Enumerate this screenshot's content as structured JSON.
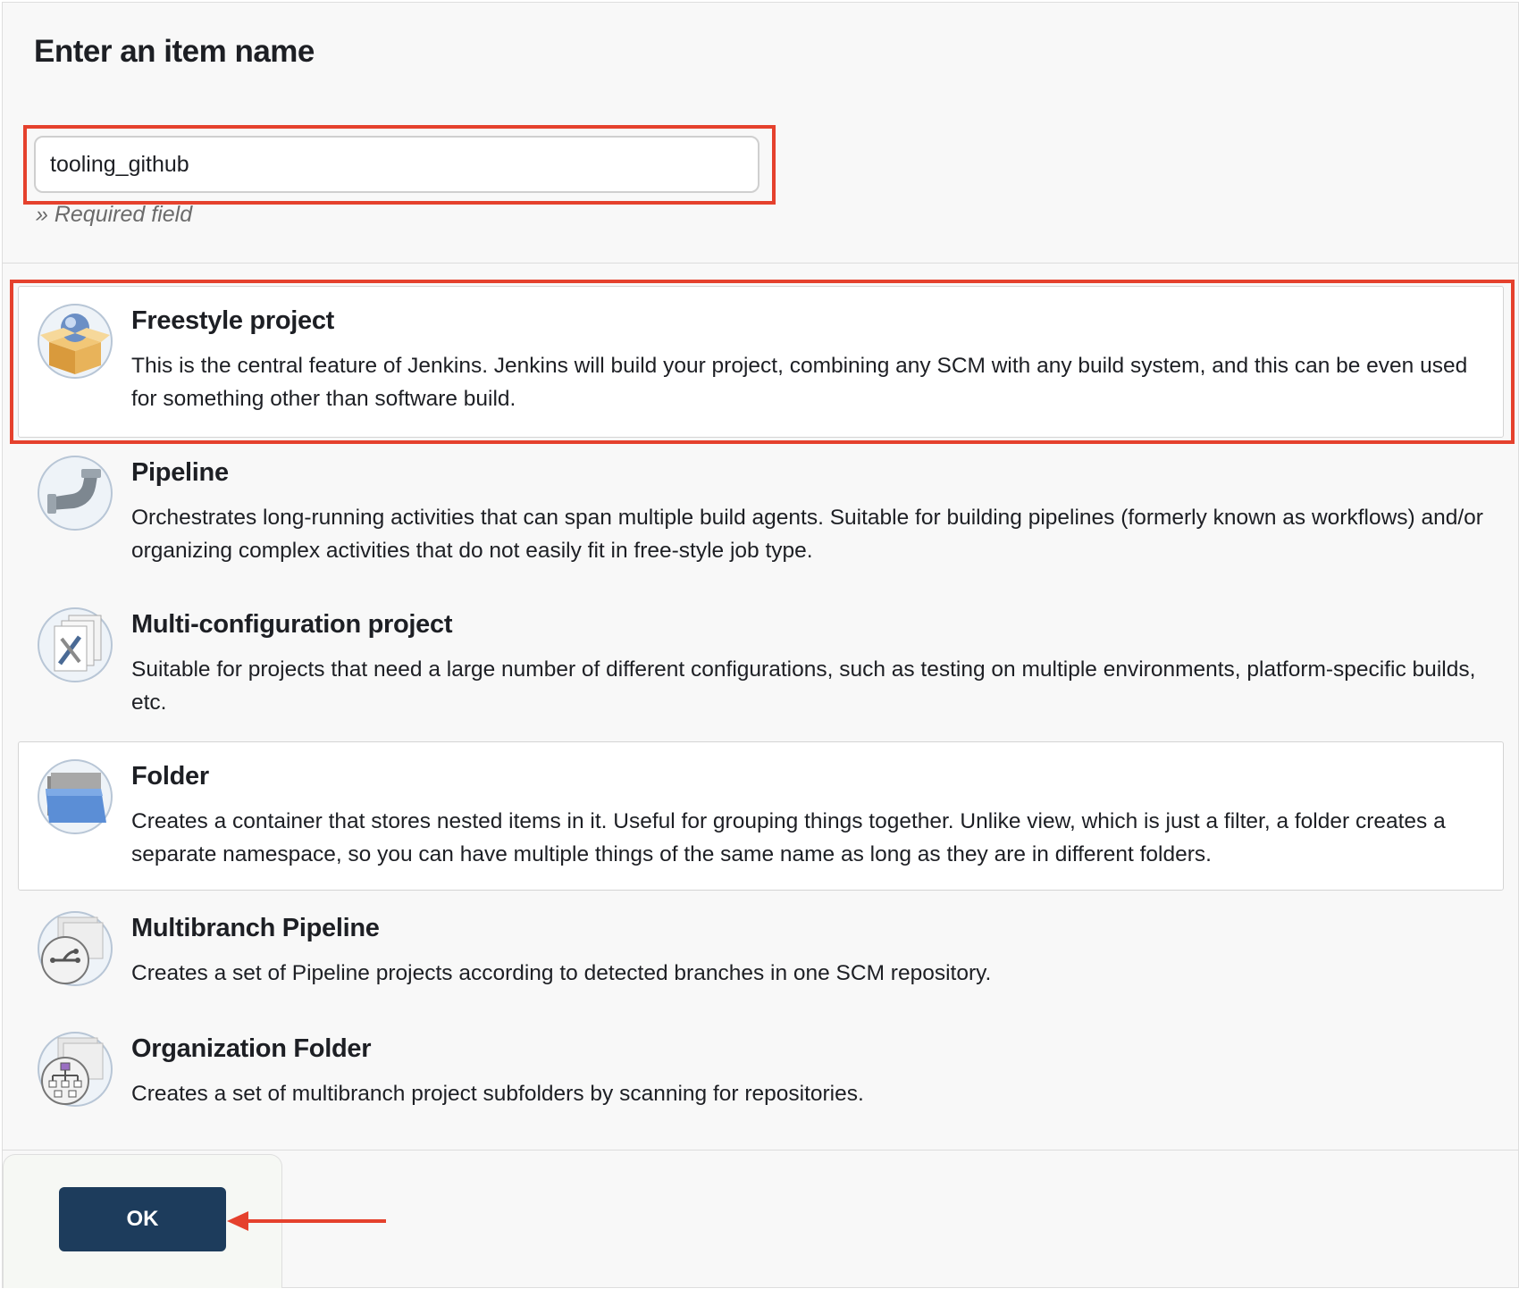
{
  "header": {
    "title": "Enter an item name"
  },
  "name_field": {
    "value": "tooling_github",
    "hint": "» Required field"
  },
  "items": [
    {
      "title": "Freestyle project",
      "description": "This is the central feature of Jenkins. Jenkins will build your project, combining any SCM with any build system, and this can be even used for something other than software build.",
      "icon": "freestyle-box-icon",
      "selected": true
    },
    {
      "title": "Pipeline",
      "description": "Orchestrates long-running activities that can span multiple build agents. Suitable for building pipelines (formerly known as workflows) and/or organizing complex activities that do not easily fit in free-style job type.",
      "icon": "pipeline-pipe-icon"
    },
    {
      "title": "Multi-configuration project",
      "description": "Suitable for projects that need a large number of different configurations, such as testing on multiple environments, platform-specific builds, etc.",
      "icon": "multi-config-icon"
    },
    {
      "title": "Folder",
      "description": "Creates a container that stores nested items in it. Useful for grouping things together. Unlike view, which is just a filter, a folder creates a separate namespace, so you can have multiple things of the same name as long as they are in different folders.",
      "icon": "folder-icon"
    },
    {
      "title": "Multibranch Pipeline",
      "description": "Creates a set of Pipeline projects according to detected branches in one SCM repository.",
      "icon": "multibranch-icon"
    },
    {
      "title": "Organization Folder",
      "description": "Creates a set of multibranch project subfolders by scanning for repositories.",
      "icon": "organization-folder-icon"
    }
  ],
  "footer": {
    "ok_label": "OK"
  },
  "colors": {
    "annotation": "#e5412d",
    "button": "#1d3c5c",
    "background": "#f8f8f8"
  }
}
